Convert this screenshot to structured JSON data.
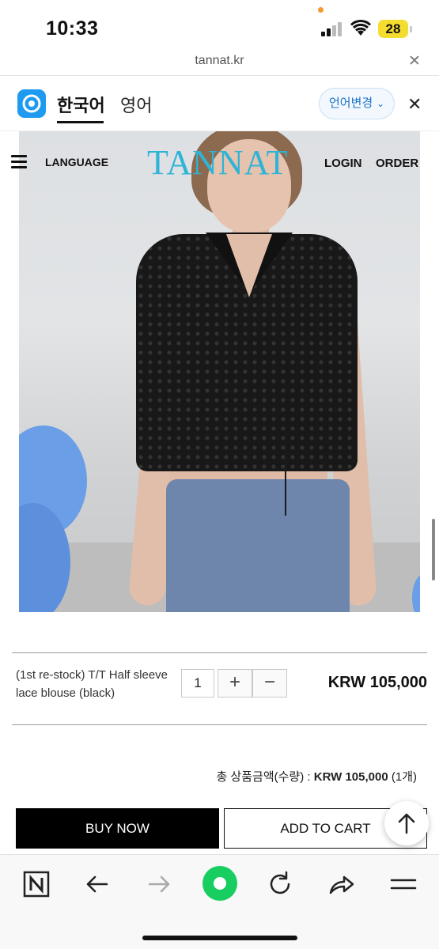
{
  "status_bar": {
    "time": "10:33",
    "battery": "28"
  },
  "url_bar": {
    "domain": "tannat.kr",
    "close_glyph": "✕"
  },
  "translate_bar": {
    "tabs": [
      "한국어",
      "영어"
    ],
    "change_button": "언어변경",
    "close_glyph": "✕"
  },
  "site_header": {
    "language": "LANGUAGE",
    "logo": "TANNAT",
    "login": "LOGIN",
    "order": "ORDER"
  },
  "product": {
    "name": "(1st re-stock) T/T Half sleeve lace blouse (black)",
    "quantity": "1",
    "plus": "+",
    "minus": "−",
    "price": "KRW 105,000"
  },
  "total": {
    "label": "총 상품금액(수량) : ",
    "amount": "KRW 105,000",
    "count": " (1개)"
  },
  "actions": {
    "buy_now": "BUY NOW",
    "add_to_cart": "ADD TO CART"
  },
  "colors": {
    "logo": "#2fb4d6",
    "papago": "#1e9bf0",
    "naver_green": "#19ce60",
    "battery": "#f4dd2f"
  },
  "browser_bar_icons": [
    "naver-icon",
    "back-icon",
    "forward-icon",
    "home-icon",
    "refresh-icon",
    "share-icon",
    "menu-icon"
  ]
}
